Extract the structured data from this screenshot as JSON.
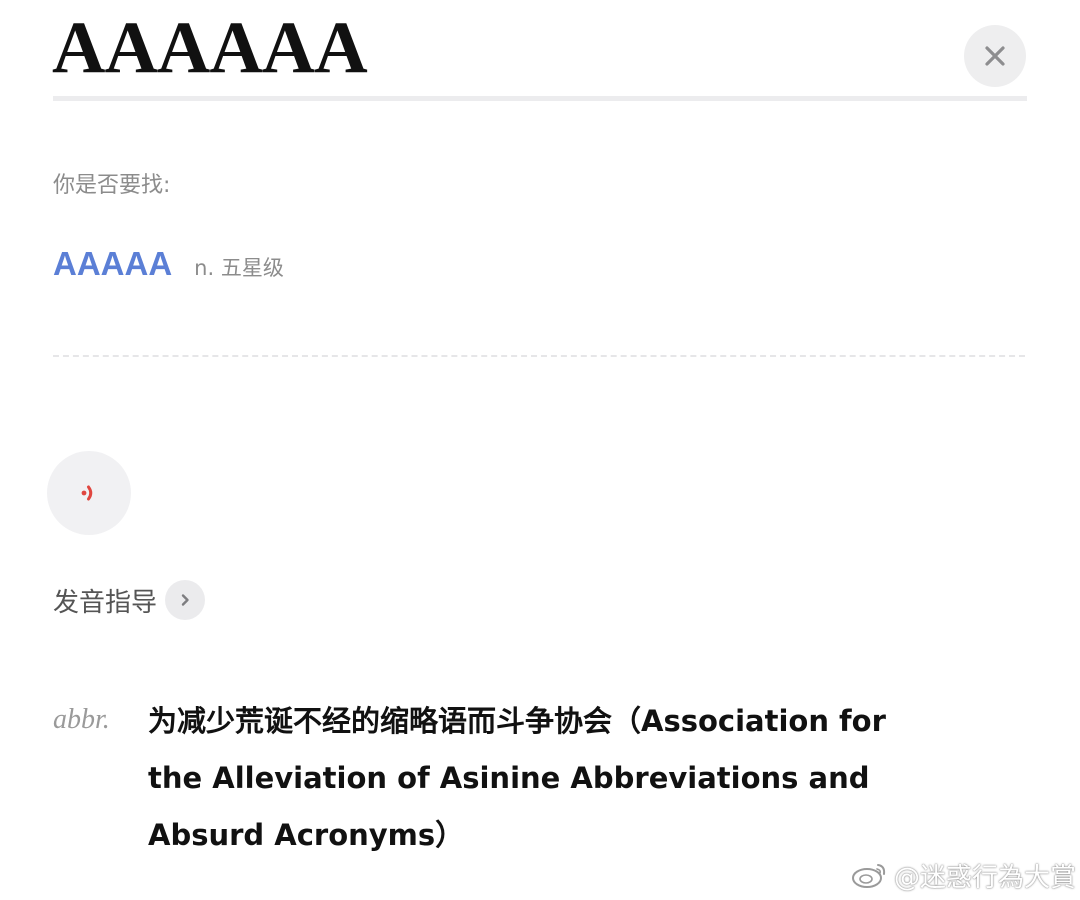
{
  "header": {
    "word": "AAAAAA",
    "close_icon": "close-icon"
  },
  "suggestion": {
    "label": "你是否要找:",
    "word": "AAAAA",
    "definition": "n. 五星级"
  },
  "pronunciation": {
    "audio_icon": "speaker-sound-icon",
    "guide_label": "发音指导",
    "chevron_icon": "chevron-right-icon"
  },
  "definition": {
    "pos": "abbr.",
    "text": "为减少荒诞不经的缩略语而斗争协会（Association for the Alleviation of Asinine Abbreviations and Absurd Acronyms）"
  },
  "watermark": {
    "icon": "weibo-logo",
    "text": "@迷惑行為大賞"
  },
  "colors": {
    "accent_link": "#5b7fd6",
    "audio_icon": "#e0463f",
    "muted_text": "#8c8c8c"
  }
}
